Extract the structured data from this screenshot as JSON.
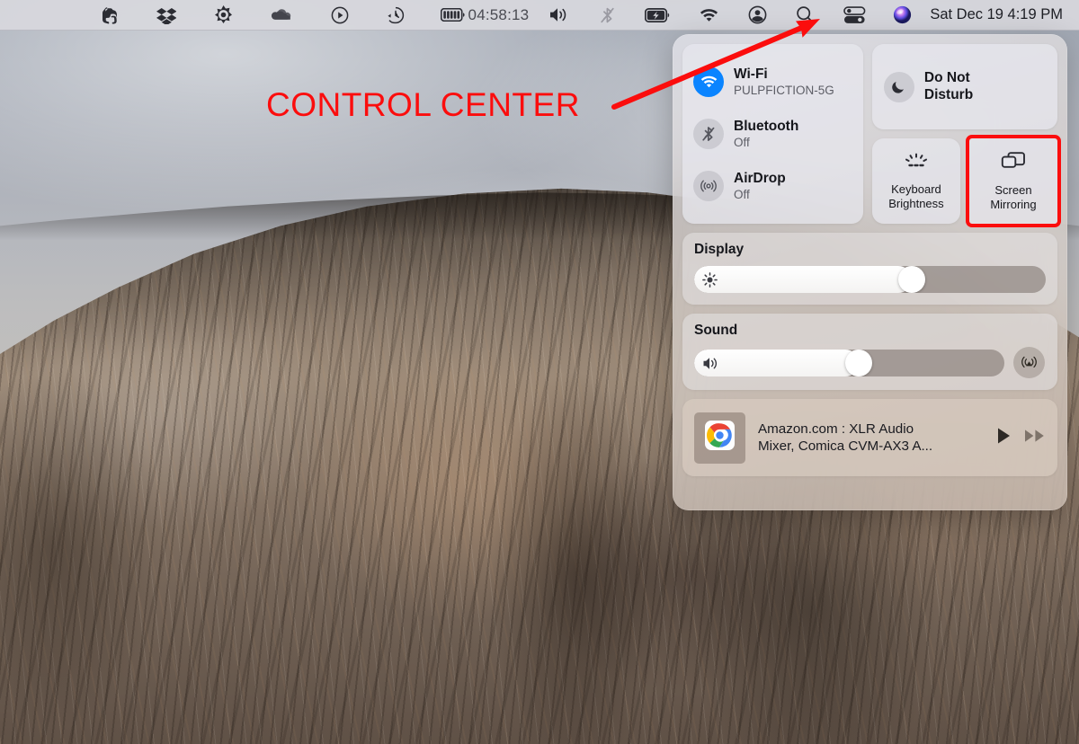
{
  "menubar": {
    "icons": [
      {
        "name": "evernote-icon",
        "label": "Evernote"
      },
      {
        "name": "dropbox-icon",
        "label": "Dropbox"
      },
      {
        "name": "avast-icon",
        "label": "Avast"
      },
      {
        "name": "onedrive-icon",
        "label": "OneDrive"
      },
      {
        "name": "play-circle-icon",
        "label": "Media Player"
      },
      {
        "name": "time-machine-icon",
        "label": "Time Machine"
      },
      {
        "name": "battery-timer-icon",
        "label": "Battery Timer"
      }
    ],
    "battery_timer": "04:58:13",
    "right_icons": [
      {
        "name": "volume-icon",
        "label": "Volume"
      },
      {
        "name": "bluetooth-off-icon",
        "label": "Bluetooth Off"
      },
      {
        "name": "battery-charging-icon",
        "label": "Battery Charging"
      },
      {
        "name": "wifi-icon",
        "label": "Wi-Fi"
      },
      {
        "name": "user-account-icon",
        "label": "Fast User Switching"
      },
      {
        "name": "search-icon",
        "label": "Spotlight Search"
      },
      {
        "name": "control-center-icon",
        "label": "Control Center"
      },
      {
        "name": "siri-icon",
        "label": "Siri"
      }
    ],
    "clock": "Sat Dec 19  4:19 PM"
  },
  "annotation": {
    "text": "CONTROL CENTER",
    "color": "#fb0d0d",
    "arrow_from": "683,118",
    "arrow_to": "912,21"
  },
  "control_center": {
    "toggles": [
      {
        "name": "wifi",
        "title": "Wi-Fi",
        "subtitle": "PULPFICTION-5G",
        "state": "on",
        "icon": "wifi-icon"
      },
      {
        "name": "bluetooth",
        "title": "Bluetooth",
        "subtitle": "Off",
        "state": "off",
        "icon": "bluetooth-off-icon"
      },
      {
        "name": "airdrop",
        "title": "AirDrop",
        "subtitle": "Off",
        "state": "off",
        "icon": "airdrop-icon"
      }
    ],
    "do_not_disturb": {
      "label": "Do Not\nDisturb",
      "line1": "Do Not",
      "line2": "Disturb",
      "icon": "moon-icon",
      "state": "off"
    },
    "tiles": [
      {
        "name": "keyboard-brightness",
        "line1": "Keyboard",
        "line2": "Brightness",
        "icon": "keyboard-brightness-icon",
        "highlighted": false
      },
      {
        "name": "screen-mirroring",
        "line1": "Screen",
        "line2": "Mirroring",
        "icon": "screen-mirroring-icon",
        "highlighted": true
      }
    ],
    "display": {
      "title": "Display",
      "value": 62,
      "icon": "brightness-icon"
    },
    "sound": {
      "title": "Sound",
      "value": 53,
      "icon": "speaker-icon",
      "airplay_icon": "airplay-icon"
    },
    "media": {
      "app_icon": "chrome-icon",
      "title": "Amazon.com : XLR Audio Mixer, Comica CVM-AX3 A...",
      "line1": "Amazon.com : XLR Audio",
      "line2": "Mixer, Comica CVM-AX3 A...",
      "play_icon": "play-icon",
      "next_icon": "fast-forward-icon"
    }
  },
  "colors": {
    "accent_blue": "#0a84ff",
    "annotation_red": "#fb0d0d",
    "menubar_bg": "#d8d8dd",
    "panel_text": "#16171c"
  }
}
